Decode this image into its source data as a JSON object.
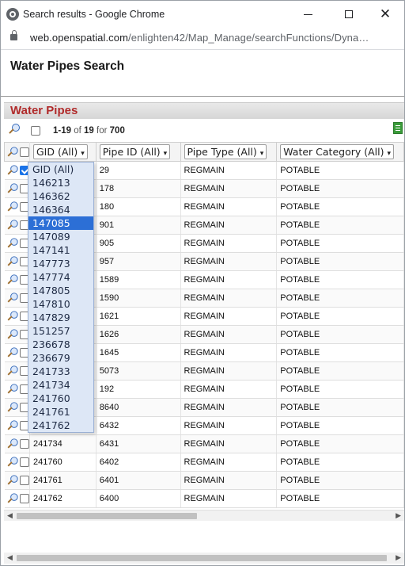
{
  "window": {
    "title": "Search results - Google Chrome",
    "url_host": "web.openspatial.com",
    "url_path": "/enlighten42/Map_Manage/searchFunctions/Dyna…",
    "minimize_glyph": "",
    "maximize_glyph": "",
    "close_glyph": "✕"
  },
  "page": {
    "title": "Water Pipes Search",
    "section_title": "Water Pipes"
  },
  "toolbar": {
    "range": "1-19",
    "of_label": "of",
    "total_matched": "19",
    "for_label": "for",
    "total": "700"
  },
  "grid": {
    "columns": [
      {
        "label": "GID (All)"
      },
      {
        "label": "Pipe ID (All)"
      },
      {
        "label": "Pipe Type (All)"
      },
      {
        "label": "Water Category (All)"
      }
    ],
    "rows": [
      {
        "gid": "",
        "pipe_id": "29",
        "pipe_type": "REGMAIN",
        "water_category": "POTABLE"
      },
      {
        "gid": "",
        "pipe_id": "178",
        "pipe_type": "REGMAIN",
        "water_category": "POTABLE"
      },
      {
        "gid": "",
        "pipe_id": "180",
        "pipe_type": "REGMAIN",
        "water_category": "POTABLE"
      },
      {
        "gid": "",
        "pipe_id": "901",
        "pipe_type": "REGMAIN",
        "water_category": "POTABLE"
      },
      {
        "gid": "",
        "pipe_id": "905",
        "pipe_type": "REGMAIN",
        "water_category": "POTABLE"
      },
      {
        "gid": "",
        "pipe_id": "957",
        "pipe_type": "REGMAIN",
        "water_category": "POTABLE"
      },
      {
        "gid": "",
        "pipe_id": "1589",
        "pipe_type": "REGMAIN",
        "water_category": "POTABLE"
      },
      {
        "gid": "",
        "pipe_id": "1590",
        "pipe_type": "REGMAIN",
        "water_category": "POTABLE"
      },
      {
        "gid": "",
        "pipe_id": "1621",
        "pipe_type": "REGMAIN",
        "water_category": "POTABLE"
      },
      {
        "gid": "",
        "pipe_id": "1626",
        "pipe_type": "REGMAIN",
        "water_category": "POTABLE"
      },
      {
        "gid": "",
        "pipe_id": "1645",
        "pipe_type": "REGMAIN",
        "water_category": "POTABLE"
      },
      {
        "gid": "",
        "pipe_id": "5073",
        "pipe_type": "REGMAIN",
        "water_category": "POTABLE"
      },
      {
        "gid": "",
        "pipe_id": "192",
        "pipe_type": "REGMAIN",
        "water_category": "POTABLE"
      },
      {
        "gid": "",
        "pipe_id": "8640",
        "pipe_type": "REGMAIN",
        "water_category": "POTABLE"
      },
      {
        "gid": "",
        "pipe_id": "6432",
        "pipe_type": "REGMAIN",
        "water_category": "POTABLE"
      },
      {
        "gid": "241734",
        "pipe_id": "6431",
        "pipe_type": "REGMAIN",
        "water_category": "POTABLE"
      },
      {
        "gid": "241760",
        "pipe_id": "6402",
        "pipe_type": "REGMAIN",
        "water_category": "POTABLE"
      },
      {
        "gid": "241761",
        "pipe_id": "6401",
        "pipe_type": "REGMAIN",
        "water_category": "POTABLE"
      },
      {
        "gid": "241762",
        "pipe_id": "6400",
        "pipe_type": "REGMAIN",
        "water_category": "POTABLE"
      }
    ]
  },
  "gid_filter_dropdown": {
    "options": [
      "GID (All)",
      "146213",
      "146362",
      "146364",
      "147085",
      "147089",
      "147141",
      "147773",
      "147774",
      "147805",
      "147810",
      "147829",
      "151257",
      "236678",
      "236679",
      "241733",
      "241734",
      "241760",
      "241761",
      "241762"
    ],
    "selected": "147085"
  },
  "icons": {
    "zoom": "magnifier-icon",
    "export": "excel-icon",
    "lock": "lock-icon",
    "browser": "chrome-icon",
    "dropdown_caret": "▾",
    "scroll_left": "◀",
    "scroll_right": "▶"
  }
}
